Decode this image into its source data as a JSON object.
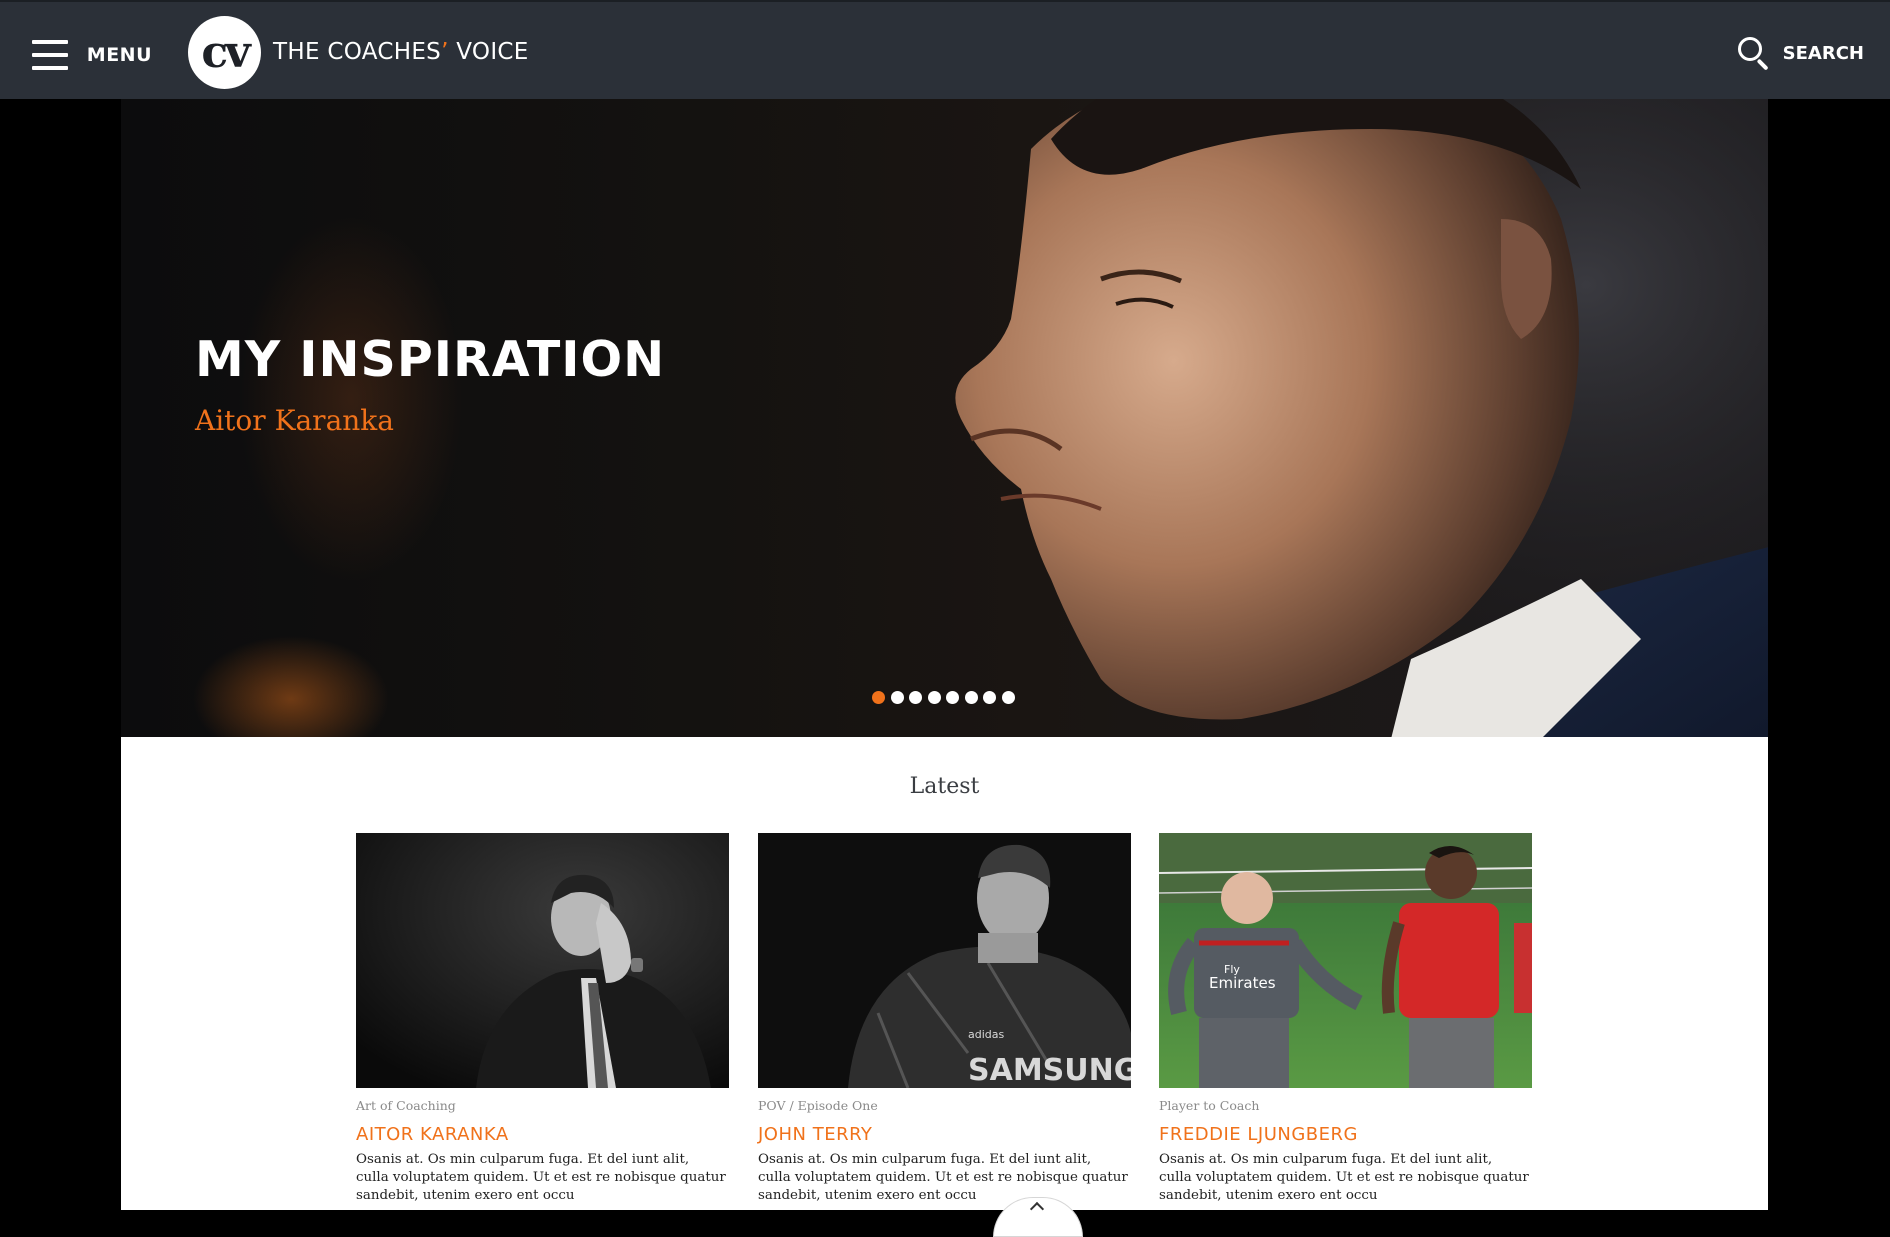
{
  "header": {
    "menu_label": "MENU",
    "logo_mark": "cv",
    "logo_text_before": "THE COACHES",
    "logo_text_apostrophe": "’",
    "logo_text_after": " VOICE",
    "search_label": "SEARCH"
  },
  "hero": {
    "title": "MY INSPIRATION",
    "subtitle": "Aitor Karanka",
    "slide_count": 8,
    "active_slide": 1
  },
  "latest": {
    "heading": "Latest",
    "cards": [
      {
        "category": "Art of Coaching",
        "name": "AITOR KARANKA",
        "excerpt": "Osanis at. Os min culparum fuga. Et del iunt alit, culla voluptatem quidem. Ut et est re nobisque quatur sandebit, utenim exero ent occu"
      },
      {
        "category": "POV / Episode One",
        "name": "JOHN TERRY",
        "excerpt": "Osanis at. Os min culparum fuga. Et del iunt alit, culla voluptatem quidem. Ut et est re nobisque quatur sandebit, utenim exero ent occu"
      },
      {
        "category": "Player to Coach",
        "name": "FREDDIE LJUNGBERG",
        "excerpt": "Osanis at. Os min culparum fuga. Et del iunt alit, culla voluptatem quidem. Ut et est re nobisque quatur sandebit, utenim exero ent occu"
      }
    ]
  },
  "images": {
    "card3_jersey_text_1": "Fly",
    "card3_jersey_text_2": "Emirates",
    "card2_jersey_text": "SAMSUNG",
    "card2_jersey_brand": "adidas"
  },
  "colors": {
    "accent": "#f0721b",
    "header_bg": "#2b3038",
    "page_bg": "#000000"
  },
  "icons": {
    "menu": "hamburger-icon",
    "search": "search-icon",
    "scroll_top": "chevron-up-icon"
  }
}
